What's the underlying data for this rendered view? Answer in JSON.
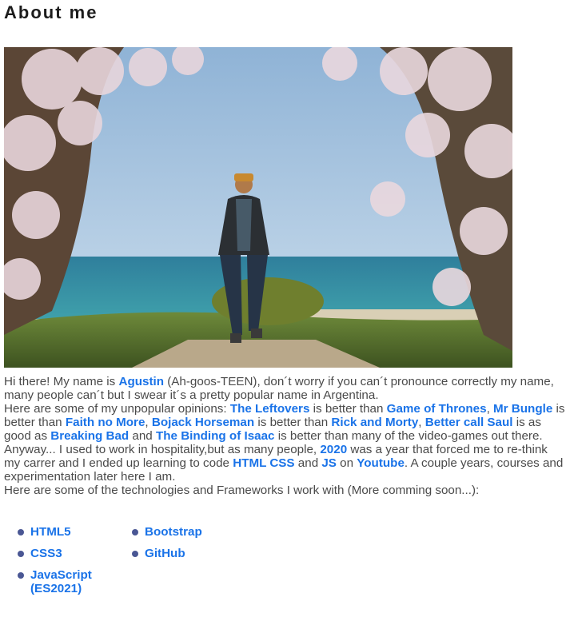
{
  "page": {
    "title": "About me"
  },
  "photo": {
    "alt": "Person walking on a path under blossoming trees by the sea"
  },
  "bio": {
    "p1": {
      "t1": "Hi there! My name is ",
      "name_link": "Agustin",
      "t2": " (Ah-goos-TEEN), don´t worry if you can´t pronounce correctly my name, many people can´t but I swear it´s a pretty popular name in Argentina."
    },
    "p2": {
      "t1": "Here are some of my unpopular opinions: ",
      "l1": "The Leftovers",
      "t2": " is better than ",
      "l2": "Game of Thrones",
      "t3": ", ",
      "l3": "Mr Bungle",
      "t4": " is better than ",
      "l4": "Faith no More",
      "t5": ", ",
      "l5": "Bojack Horseman",
      "t6": " is better than ",
      "l6": "Rick and Morty",
      "t7": ", ",
      "l7": "Better call Saul",
      "t8": " is as good as ",
      "l8": "Breaking Bad",
      "t9": " and ",
      "l9": "The Binding of Isaac",
      "t10": " is better than many of the video-games out there."
    },
    "p3": {
      "t1": "Anyway... I used to work in hospitality,but as many people, ",
      "l1": "2020",
      "t2": " was a year that forced me to re-think my carrer and I ended up learning to code ",
      "l2": "HTML CSS",
      "t3": " and ",
      "l3": "JS",
      "t4": " on ",
      "l4": "Youtube",
      "t5": ". A couple years, courses and experimentation later here I am."
    },
    "p4": "Here are some of the technologies and Frameworks I work with (More comming soon...):"
  },
  "tech": {
    "html5": "HTML5",
    "bootstrap": "Bootstrap",
    "css3": "CSS3",
    "github": "GitHub",
    "javascript": "JavaScript (ES2021)"
  },
  "colors": {
    "link": "#1a73e8",
    "bullet": "#4a5794",
    "text": "#4a4a4a",
    "heading": "#1c1c1c"
  }
}
